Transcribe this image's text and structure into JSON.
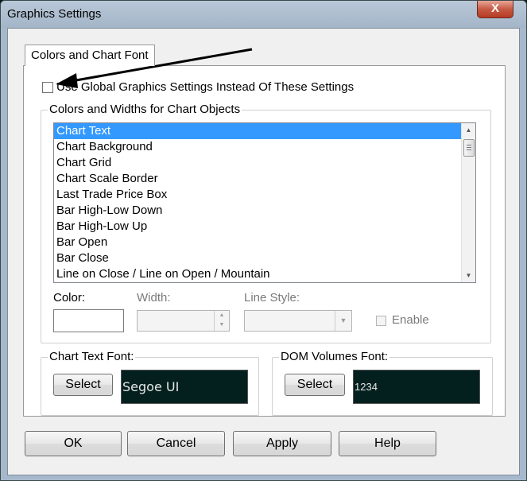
{
  "window": {
    "title": "Graphics Settings",
    "close_glyph": "X"
  },
  "tabs": [
    {
      "label": "Colors and Chart Font"
    }
  ],
  "global_setting": {
    "label": "Use Global Graphics Settings Instead Of These Settings",
    "checked": false
  },
  "colors_group": {
    "title": "Colors and Widths for Chart Objects",
    "items": [
      "Chart Text",
      "Chart Background",
      "Chart Grid",
      "Chart Scale Border",
      "Last Trade Price Box",
      "Bar High-Low Down",
      "Bar High-Low Up",
      "Bar Open",
      "Bar Close",
      "Line on Close / Line on Open / Mountain"
    ],
    "selected_index": 0,
    "color_label": "Color:",
    "width_label": "Width:",
    "line_style_label": "Line Style:",
    "enable_label": "Enable",
    "color_value": "#ffffff"
  },
  "chart_text_font": {
    "title": "Chart Text Font:",
    "select_label": "Select",
    "preview_text": "Segoe UI"
  },
  "dom_volumes_font": {
    "title": "DOM Volumes Font:",
    "select_label": "Select",
    "preview_text": "1234"
  },
  "buttons": {
    "ok": "OK",
    "cancel": "Cancel",
    "apply": "Apply",
    "help": "Help"
  },
  "colors": {
    "selection": "#3399ff",
    "font_preview_bg": "#03201f",
    "title_bar": "#a6b9cc",
    "close_button": "#c75a44"
  }
}
